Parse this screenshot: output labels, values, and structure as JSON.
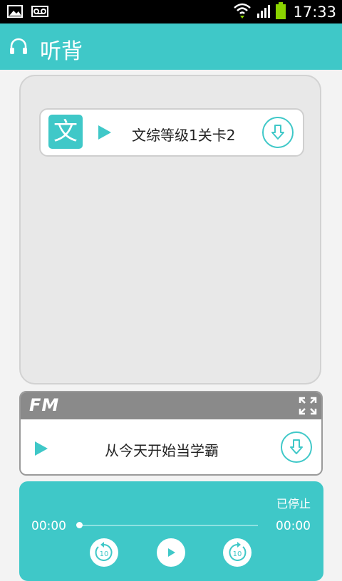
{
  "status_bar": {
    "time": "17:33",
    "icons": [
      "image-icon",
      "voicemail-icon",
      "wifi-icon",
      "signal-icon",
      "battery-icon"
    ]
  },
  "app_bar": {
    "title": "听背",
    "icon": "headphone-icon"
  },
  "lesson_list": {
    "items": [
      {
        "badge": "文",
        "title": "文综等级1关卡2"
      }
    ]
  },
  "fm": {
    "logo": "FM",
    "item_title": "从今天开始当学霸"
  },
  "player": {
    "status": "已停止",
    "time_current": "00:00",
    "time_total": "00:00",
    "progress": 0,
    "rewind_label": "10",
    "forward_label": "10"
  },
  "colors": {
    "accent": "#3fc8c8",
    "fm_header": "#8a8a8a",
    "panel_bg": "#e8e8e8"
  }
}
